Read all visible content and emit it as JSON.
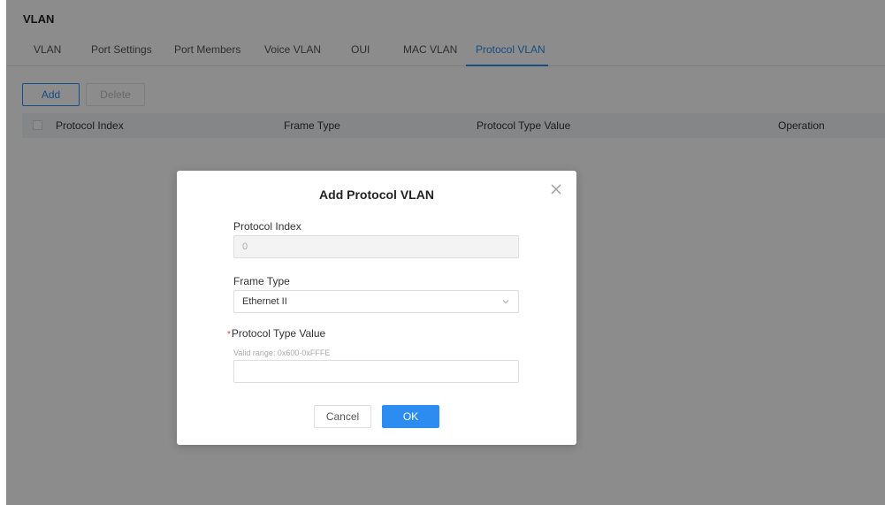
{
  "page": {
    "title": "VLAN"
  },
  "tabs": [
    {
      "label": "VLAN"
    },
    {
      "label": "Port Settings"
    },
    {
      "label": "Port Members"
    },
    {
      "label": "Voice VLAN"
    },
    {
      "label": "OUI"
    },
    {
      "label": "MAC VLAN"
    },
    {
      "label": "Protocol VLAN",
      "active": true
    }
  ],
  "toolbar": {
    "add_label": "Add",
    "delete_label": "Delete"
  },
  "table": {
    "columns": [
      "Protocol Index",
      "Frame Type",
      "Protocol Type Value",
      "Operation"
    ],
    "rows": []
  },
  "modal": {
    "title": "Add Protocol VLAN",
    "close_icon": "close-icon",
    "protocol_index": {
      "label": "Protocol Index",
      "value": "0"
    },
    "frame_type": {
      "label": "Frame Type",
      "value": "Ethernet II"
    },
    "protocol_type_value": {
      "required_mark": "*",
      "label": "Protocol Type Value",
      "hint": "Valid range: 0x600-0xFFFE",
      "value": ""
    },
    "cancel_label": "Cancel",
    "ok_label": "OK"
  },
  "colors": {
    "accent": "#2d8cf0",
    "required": "#ed4014"
  }
}
